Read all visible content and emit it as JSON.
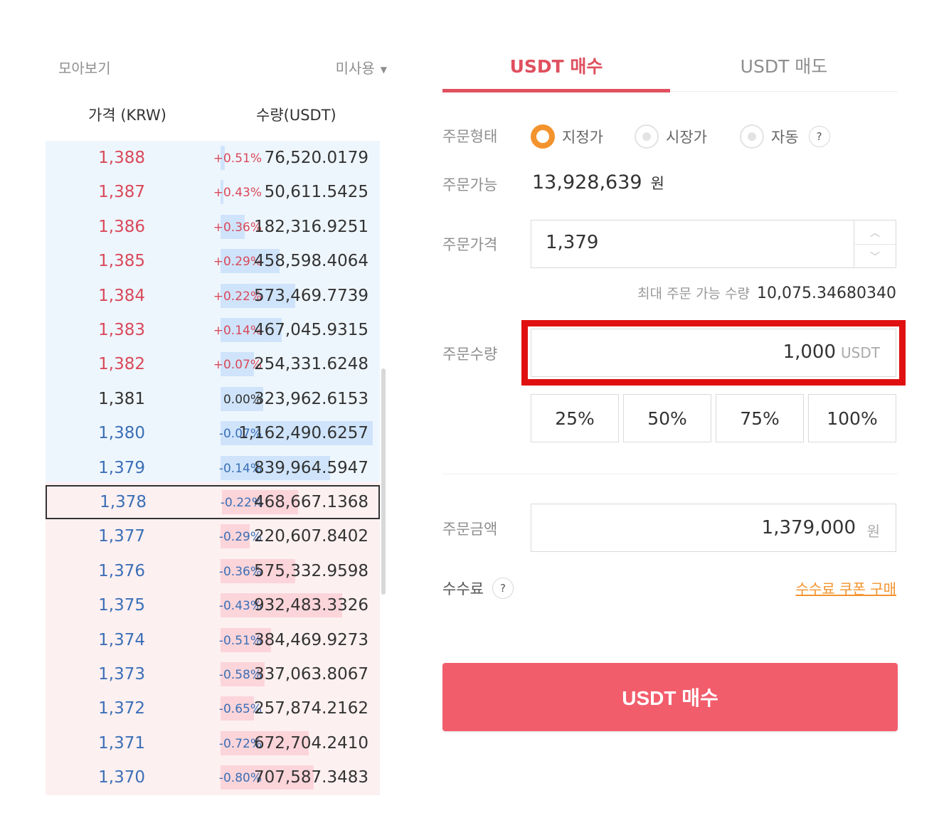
{
  "orderbook": {
    "title": "모아보기",
    "mode": "미사용",
    "col_price": "가격 (KRW)",
    "col_qty": "수량(USDT)",
    "rows": [
      {
        "price": "1,388",
        "change": "+0.51%",
        "qty": "76,520.0179",
        "side": "ask",
        "depth": 0.03
      },
      {
        "price": "1,387",
        "change": "+0.43%",
        "qty": "50,611.5425",
        "side": "ask",
        "depth": 0.02
      },
      {
        "price": "1,386",
        "change": "+0.36%",
        "qty": "182,316.9251",
        "side": "ask",
        "depth": 0.16
      },
      {
        "price": "1,385",
        "change": "+0.29%",
        "qty": "458,598.4064",
        "side": "ask",
        "depth": 0.39
      },
      {
        "price": "1,384",
        "change": "+0.22%",
        "qty": "573,469.7739",
        "side": "ask",
        "depth": 0.49
      },
      {
        "price": "1,383",
        "change": "+0.14%",
        "qty": "467,045.9315",
        "side": "ask",
        "depth": 0.4
      },
      {
        "price": "1,382",
        "change": "+0.07%",
        "qty": "254,331.6248",
        "side": "ask",
        "depth": 0.22
      },
      {
        "price": "1,381",
        "change": "0.00%",
        "qty": "323,962.6153",
        "side": "flat",
        "depth": 0.28
      },
      {
        "price": "1,380",
        "change": "-0.07%",
        "qty": "1,162,490.6257",
        "side": "bid",
        "depth": 1.0
      },
      {
        "price": "1,379",
        "change": "-0.14%",
        "qty": "839,964.5947",
        "side": "bid",
        "depth": 0.72
      },
      {
        "price": "1,378",
        "change": "-0.22%",
        "qty": "468,667.1368",
        "side": "bid",
        "depth": 0.5,
        "current": true
      },
      {
        "price": "1,377",
        "change": "-0.29%",
        "qty": "220,607.8402",
        "side": "bid",
        "depth": 0.19
      },
      {
        "price": "1,376",
        "change": "-0.36%",
        "qty": "575,332.9598",
        "side": "bid",
        "depth": 0.49
      },
      {
        "price": "1,375",
        "change": "-0.43%",
        "qty": "932,483.3326",
        "side": "bid",
        "depth": 0.8
      },
      {
        "price": "1,374",
        "change": "-0.51%",
        "qty": "384,469.9273",
        "side": "bid",
        "depth": 0.33
      },
      {
        "price": "1,373",
        "change": "-0.58%",
        "qty": "337,063.8067",
        "side": "bid",
        "depth": 0.29
      },
      {
        "price": "1,372",
        "change": "-0.65%",
        "qty": "257,874.2162",
        "side": "bid",
        "depth": 0.22
      },
      {
        "price": "1,371",
        "change": "-0.72%",
        "qty": "672,704.2410",
        "side": "bid",
        "depth": 0.58
      },
      {
        "price": "1,370",
        "change": "-0.80%",
        "qty": "707,587.3483",
        "side": "bid",
        "depth": 0.61
      }
    ]
  },
  "tabs": {
    "buy": "USDT 매수",
    "sell": "USDT 매도"
  },
  "order": {
    "type_label": "주문형태",
    "types": [
      "지정가",
      "시장가",
      "자동"
    ],
    "help": "?",
    "avail_label": "주문가능",
    "avail_value": "13,928,639",
    "krw_unit": "원",
    "price_label": "주문가격",
    "price_value": "1,379",
    "max_label": "최대 주문 가능 수량",
    "max_value": "10,075.34680340",
    "qty_label": "주문수량",
    "qty_value": "1,000",
    "qty_unit": "USDT",
    "percents": [
      "25%",
      "50%",
      "75%",
      "100%"
    ],
    "total_label": "주문금액",
    "total_value": "1,379,000",
    "fee_label": "수수료",
    "coupon": "수수료 쿠폰 구매",
    "submit": "USDT 매수"
  },
  "colors": {
    "ask": "#d9495a",
    "bid": "#3b6fb6",
    "accent": "#e0505f",
    "button": "#f25d6c",
    "radio_on": "#f3932d",
    "highlight": "#e01010"
  }
}
